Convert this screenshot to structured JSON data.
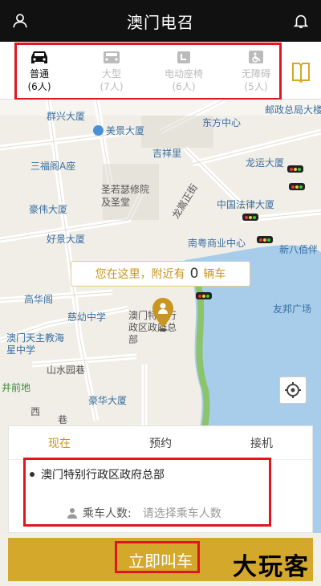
{
  "header": {
    "title": "澳门电召",
    "left_icon": "user-icon",
    "right_icon": "bell-icon"
  },
  "vehicle_tabs": [
    {
      "name": "普通",
      "count": "(6人)",
      "icon": "car-icon"
    },
    {
      "name": "大型",
      "count": "(7人)",
      "icon": "van-icon"
    },
    {
      "name": "电动座椅",
      "count": "(6人)",
      "icon": "seat-icon"
    },
    {
      "name": "无障碍",
      "count": "(5人)",
      "icon": "wheelchair-icon"
    }
  ],
  "map": {
    "labels": [
      "群兴大厦",
      "邮政总局大楼",
      "东方中心",
      "美景大厦",
      "吉祥里",
      "三福阁A座",
      "龙运大厦",
      "圣若瑟修院及圣堂",
      "龙嵩正街",
      "豪伟大厦",
      "中国法律大厦",
      "好景大厦",
      "南粤商业中心",
      "新八佰伴",
      "高华阁",
      "慈幼中学",
      "澳门特别行政区政府总部",
      "友邦广场",
      "澳门天主教海星中学",
      "山水园巷",
      "井前地",
      "豪华大厦",
      "西",
      "巷"
    ],
    "bubble": {
      "prefix": "您在这里，附近有",
      "count": "0",
      "suffix": "辆车"
    }
  },
  "booking_panel": {
    "tabs": [
      "现在",
      "预约",
      "接机"
    ],
    "location": "澳门特别行政区政府总部",
    "passenger_label": "乘车人数:",
    "passenger_placeholder": "请选择乘车人数"
  },
  "call_button": "立即叫车",
  "watermark": "大玩客",
  "colors": {
    "accent": "#d4a82a",
    "highlight_box": "#e0161c"
  }
}
